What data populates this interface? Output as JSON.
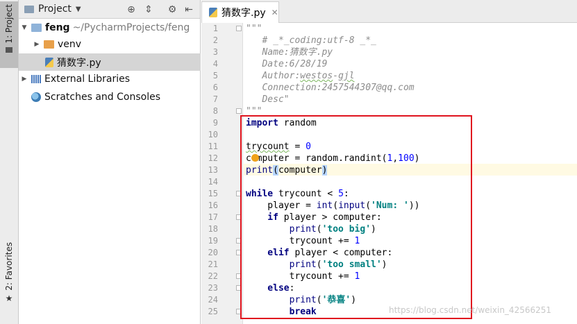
{
  "sidebar": {
    "project_tab": "1: Project",
    "favorites_tab": "2: Favorites"
  },
  "project_panel": {
    "title": "Project",
    "tree": {
      "root_name": "feng",
      "root_path": "~/PycharmProjects/feng",
      "venv": "venv",
      "file": "猜数字.py",
      "external_libraries": "External Libraries",
      "scratches": "Scratches and Consoles"
    }
  },
  "editor": {
    "tab_label": "猜数字.py",
    "line_numbers": [
      "1",
      "2",
      "3",
      "4",
      "5",
      "6",
      "7",
      "8",
      "9",
      "10",
      "11",
      "12",
      "13",
      "14",
      "15",
      "16",
      "17",
      "18",
      "19",
      "20",
      "21",
      "22",
      "23",
      "24",
      "25"
    ],
    "code": {
      "l1": "\"\"\"",
      "l2": "# _*_coding:utf-8 _*_",
      "l3": "Name:猜数字.py",
      "l4": "Date:6/28/19",
      "l5_a": "Author:",
      "l5_b": "westos",
      "l5_c": "-",
      "l5_d": "gjl",
      "l6": "Connection:2457544307@qq.com",
      "l7": "Desc\"",
      "l8": "\"\"\"",
      "kw_import": "import",
      "mod_random": " random",
      "trycount": "trycount",
      "assign_eq": " = ",
      "zero": "0",
      "computer": "computer",
      "randint_call": " = random.randint(",
      "one": "1",
      "comma": ",",
      "hundred": "100",
      "close_paren": ")",
      "print": "print",
      "open_paren": "(",
      "computer_arg": "computer",
      "kw_while": "while",
      "while_cond": " trycount < ",
      "five": "5",
      "colon": ":",
      "player_assign": "    player = ",
      "int": "int",
      "input": "input",
      "num_prompt": "'Num: '",
      "dbl_close": "))",
      "kw_if": "    if",
      "if_cond": " player > computer:",
      "print_indent": "        print",
      "too_big": "'too big'",
      "trycount_inc": "        trycount += ",
      "kw_elif": "    elif",
      "elif_cond": " player < computer:",
      "too_small": "'too small'",
      "kw_else": "    else",
      "congrats": "'恭喜'",
      "kw_break": "        break"
    },
    "watermark": "https://blog.csdn.net/weixin_42566251"
  }
}
